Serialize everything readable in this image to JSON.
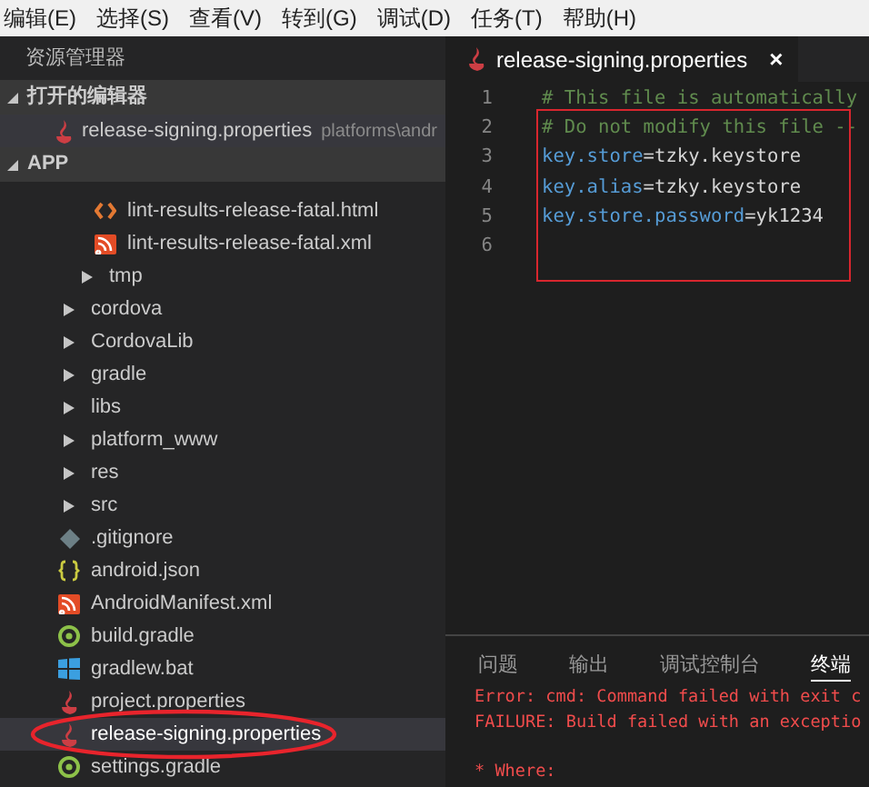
{
  "menu": [
    "编辑(E)",
    "选择(S)",
    "查看(V)",
    "转到(G)",
    "调试(D)",
    "任务(T)",
    "帮助(H)"
  ],
  "sidebar": {
    "title": "资源管理器",
    "open_editors": {
      "label": "打开的编辑器",
      "expanded": true,
      "items": [
        {
          "name": "release-signing.properties",
          "path": "platforms\\andr",
          "kind": "properties",
          "selected": true
        }
      ]
    },
    "project": {
      "label": "APP",
      "expanded": true,
      "tree": [
        {
          "kind": "group",
          "children": [
            {
              "kind": "group",
              "children": [
                {
                  "name": "lint-results-release-fatal.html",
                  "kind": "html",
                  "selected": false,
                  "circled": false
                },
                {
                  "name": "lint-results-release-fatal.xml",
                  "kind": "xml",
                  "selected": false,
                  "circled": false
                }
              ]
            },
            {
              "name": "tmp",
              "kind": "folder",
              "expanded": false,
              "selected": false,
              "circled": false
            }
          ]
        },
        {
          "name": "cordova",
          "kind": "folder",
          "expanded": false,
          "selected": false,
          "circled": false
        },
        {
          "name": "CordovaLib",
          "kind": "folder",
          "expanded": false,
          "selected": false,
          "circled": false
        },
        {
          "name": "gradle",
          "kind": "folder",
          "expanded": false,
          "selected": false,
          "circled": false
        },
        {
          "name": "libs",
          "kind": "folder",
          "expanded": false,
          "selected": false,
          "circled": false
        },
        {
          "name": "platform_www",
          "kind": "folder",
          "expanded": false,
          "selected": false,
          "circled": false
        },
        {
          "name": "res",
          "kind": "folder",
          "expanded": false,
          "selected": false,
          "circled": false
        },
        {
          "name": "src",
          "kind": "folder",
          "expanded": false,
          "selected": false,
          "circled": false
        },
        {
          "name": ".gitignore",
          "kind": "gitignore",
          "selected": false,
          "circled": false
        },
        {
          "name": "android.json",
          "kind": "json",
          "selected": false,
          "circled": false
        },
        {
          "name": "AndroidManifest.xml",
          "kind": "xml",
          "selected": false,
          "circled": false
        },
        {
          "name": "build.gradle",
          "kind": "gradle",
          "selected": false,
          "circled": false
        },
        {
          "name": "gradlew.bat",
          "kind": "bat",
          "selected": false,
          "circled": false
        },
        {
          "name": "project.properties",
          "kind": "properties",
          "selected": false,
          "circled": false
        },
        {
          "name": "release-signing.properties",
          "kind": "properties",
          "selected": true,
          "circled": true
        },
        {
          "name": "settings.gradle",
          "kind": "gradle",
          "selected": false,
          "circled": false
        }
      ]
    }
  },
  "editor": {
    "tab": {
      "name": "release-signing.properties",
      "kind": "properties",
      "close": "×"
    },
    "lines": [
      {
        "number": "1",
        "kind": "comment",
        "text": "# This file is automatically",
        "boxed": false
      },
      {
        "number": "2",
        "kind": "comment",
        "text": "# Do not modify this file --",
        "boxed": true
      },
      {
        "number": "3",
        "kind": "property",
        "key": "key.store",
        "separator": "=",
        "value": "tzky.keystore",
        "boxed": true
      },
      {
        "number": "4",
        "kind": "property",
        "key": "key.alias",
        "separator": "=",
        "value": "tzky.keystore",
        "boxed": true
      },
      {
        "number": "5",
        "kind": "property",
        "key": "key.store.password",
        "separator": "=",
        "value": "yk1234",
        "boxed": true
      },
      {
        "number": "6",
        "kind": "empty",
        "boxed": true
      }
    ]
  },
  "panel": {
    "tabs": [
      {
        "label": "问题",
        "selected": false
      },
      {
        "label": "输出",
        "selected": false
      },
      {
        "label": "调试控制台",
        "selected": false
      },
      {
        "label": "终端",
        "selected": true
      }
    ],
    "terminal": [
      {
        "kind": "line",
        "text": "Error: cmd: Command failed with exit c"
      },
      {
        "kind": "line",
        "text": "FAILURE: Build failed with an exceptio"
      },
      {
        "kind": "blank"
      },
      {
        "kind": "line",
        "text": "* Where:"
      }
    ]
  }
}
